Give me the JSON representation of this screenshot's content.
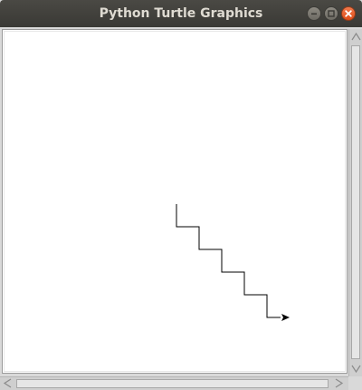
{
  "window": {
    "title": "Python Turtle Graphics"
  },
  "titlebar_buttons": [
    {
      "name": "minimize",
      "icon": "minimize-icon"
    },
    {
      "name": "maximize",
      "icon": "maximize-icon"
    },
    {
      "name": "close",
      "icon": "close-icon"
    }
  ],
  "colors": {
    "titlebar": "#3f3e3a",
    "title_text": "#dfdbd2",
    "close_button": "#e85a26",
    "canvas_background": "#ffffff",
    "pen": "#000000"
  },
  "turtle": {
    "pen_color": "#000000",
    "path_description": "staircase of 5 steps descending to the right, each step 25 units right then 25 units down, ending at the turtle facing east",
    "step_length": 25,
    "steps": 5,
    "heading": "east",
    "cursor_icon": "turtle-arrow-icon"
  },
  "scrollbars": {
    "vertical": {
      "icon_up": "scroll-up-arrow-icon",
      "icon_down": "scroll-down-arrow-icon"
    },
    "horizontal": {
      "icon_left": "scroll-left-arrow-icon",
      "icon_right": "scroll-right-arrow-icon"
    }
  }
}
